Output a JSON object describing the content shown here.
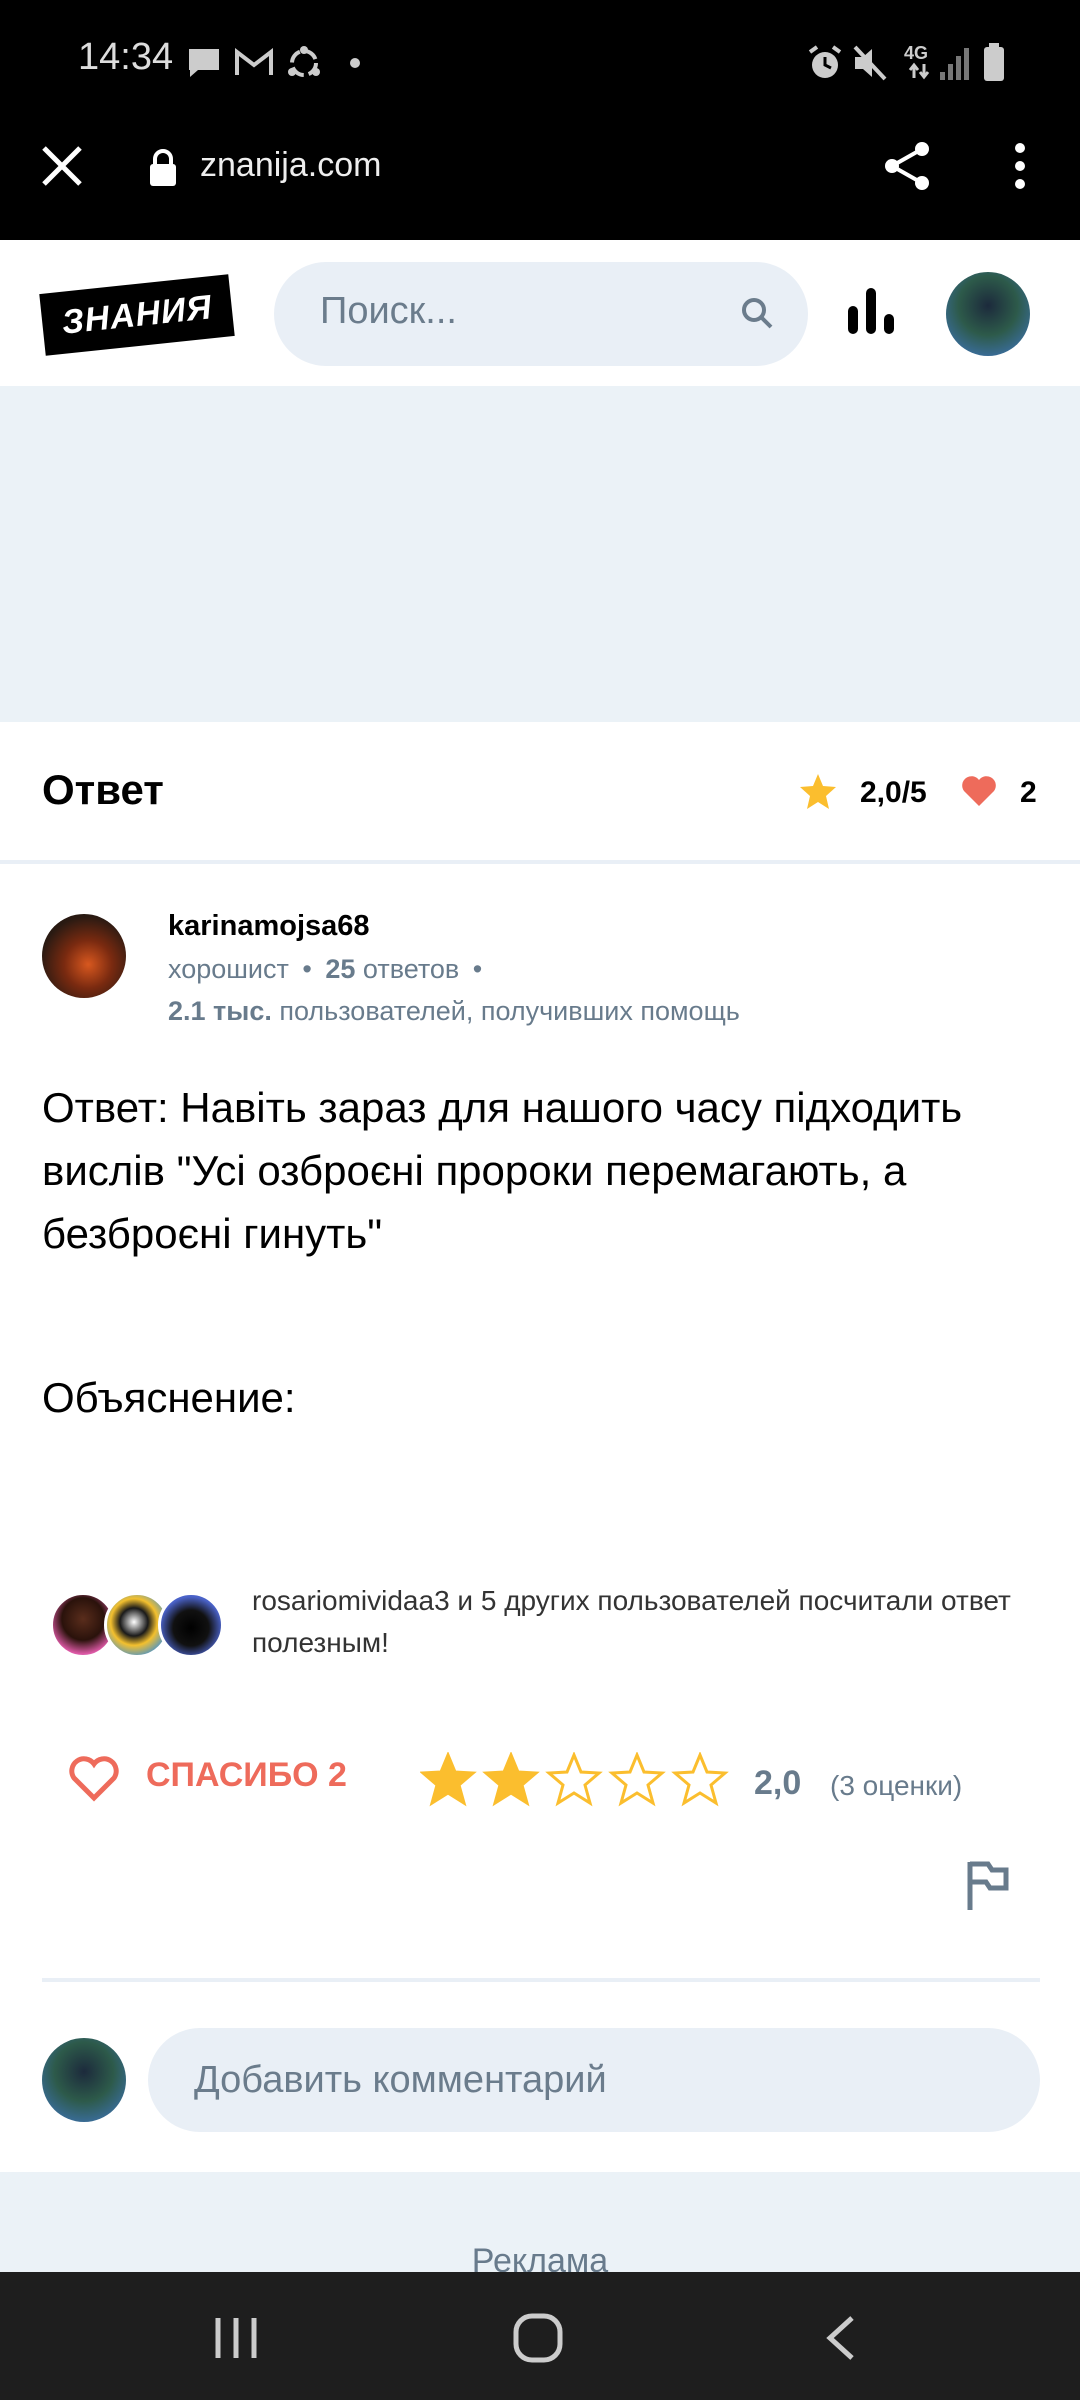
{
  "status_bar": {
    "time": "14:34",
    "network": "4G",
    "icons": [
      "chat-icon",
      "gmail-icon",
      "hub-icon",
      "dot-icon",
      "alarm-icon",
      "mute-icon",
      "signal-icon",
      "battery-icon"
    ]
  },
  "browser": {
    "url": "znanija.com",
    "icons": [
      "close-icon",
      "lock-icon",
      "share-icon",
      "more-vert-icon"
    ]
  },
  "header": {
    "logo_text": "ЗНАНИЯ",
    "search_placeholder": "Поиск...",
    "icons": [
      "search-icon",
      "stats-icon"
    ]
  },
  "answer": {
    "title": "Ответ",
    "rating": "2,0/5",
    "likes": "2",
    "author": {
      "name": "karinamojsa68",
      "rank": "хорошист",
      "answers_count": "25",
      "answers_label": "ответов",
      "helped_count": "2.1 тыс.",
      "helped_label": "пользователей, получивших помощь"
    },
    "text": "Ответ: Навіть зараз для нашого часу підходить вислів \"Усі озброєні пророки перемагають, а безброєні гинуть\"",
    "explanation": "Объяснение:",
    "helpful_text": "rosariomividaa3 и 5 других пользователей посчитали ответ полезным!",
    "thanks_label": "СПАСИБО 2",
    "stars_filled": 2,
    "stars_total": 5,
    "score": "2,0",
    "score_count": "(3 оценки)"
  },
  "comment": {
    "placeholder": "Добавить комментарий"
  },
  "ad_label": "Реклама",
  "colors": {
    "accent_red": "#ee6b5b",
    "star_yellow": "#fbbe2e",
    "muted_text": "#687b8c",
    "light_bg": "#e9eff6"
  }
}
